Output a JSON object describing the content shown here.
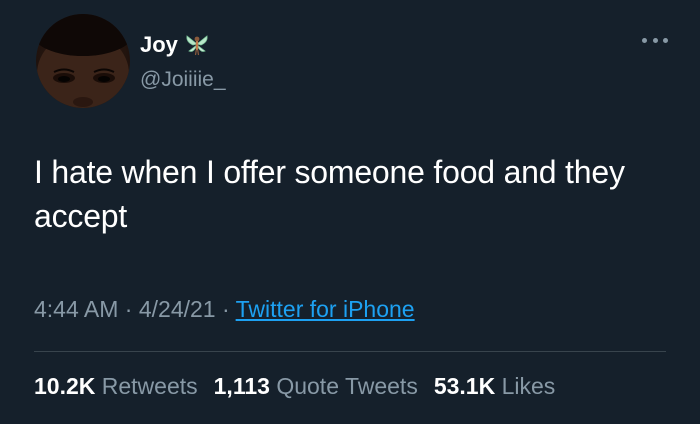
{
  "author": {
    "display_name": "Joy",
    "handle": "@Joiiiie_",
    "name_emoji": "fairy-icon",
    "avatar": "avatar-photo"
  },
  "header": {
    "more_icon": "more-horizontal-icon"
  },
  "tweet": {
    "text": "I hate when I offer someone food and they accept"
  },
  "meta": {
    "time": "4:44 AM",
    "separator1": " · ",
    "date": "4/24/21",
    "separator2": " · ",
    "source": "Twitter for iPhone"
  },
  "stats": {
    "retweets_count": "10.2K",
    "retweets_label": "Retweets",
    "quotes_count": "1,113",
    "quotes_label": "Quote Tweets",
    "likes_count": "53.1K",
    "likes_label": "Likes"
  },
  "colors": {
    "background": "#15202b",
    "text_primary": "#ffffff",
    "text_secondary": "#8899a6",
    "link": "#1da1f2",
    "divider": "#38444d"
  }
}
